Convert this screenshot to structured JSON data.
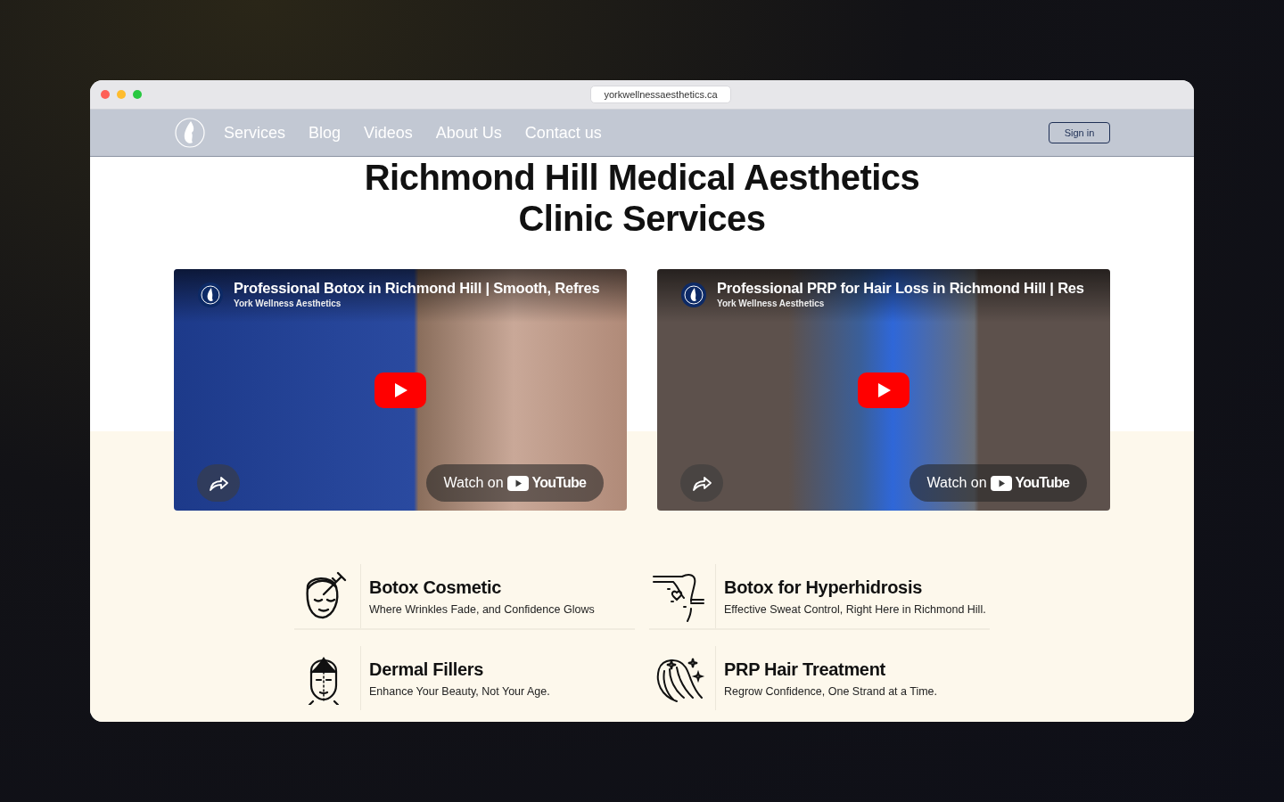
{
  "browser": {
    "url": "yorkwellnessaesthetics.ca"
  },
  "nav": {
    "links": [
      "Services",
      "Blog",
      "Videos",
      "About Us",
      "Contact us"
    ],
    "sign_in": "Sign in"
  },
  "heading": [
    "Richmond Hill Medical Aesthetics",
    "Clinic Services"
  ],
  "videos": [
    {
      "title": "Professional Botox in Richmond Hill | Smooth, Refres",
      "channel": "York Wellness Aesthetics",
      "watch": "Watch on",
      "brand": "YouTube"
    },
    {
      "title": "Professional PRP for Hair Loss in Richmond Hill | Res",
      "channel": "York Wellness Aesthetics",
      "watch": "Watch on",
      "brand": "YouTube"
    }
  ],
  "services": [
    {
      "kind": "botox",
      "title": "Botox Cosmetic",
      "subtitle": "Where Wrinkles Fade, and Confidence Glows"
    },
    {
      "kind": "hyperhidrosis",
      "title": "Botox for Hyperhidrosis",
      "subtitle": "Effective Sweat Control, Right Here in Richmond Hill."
    },
    {
      "kind": "fillers",
      "title": "Dermal Fillers",
      "subtitle": "Enhance Your Beauty, Not Your Age."
    },
    {
      "kind": "hair",
      "title": "PRP Hair Treatment",
      "subtitle": "Regrow Confidence, One Strand at a Time."
    }
  ]
}
